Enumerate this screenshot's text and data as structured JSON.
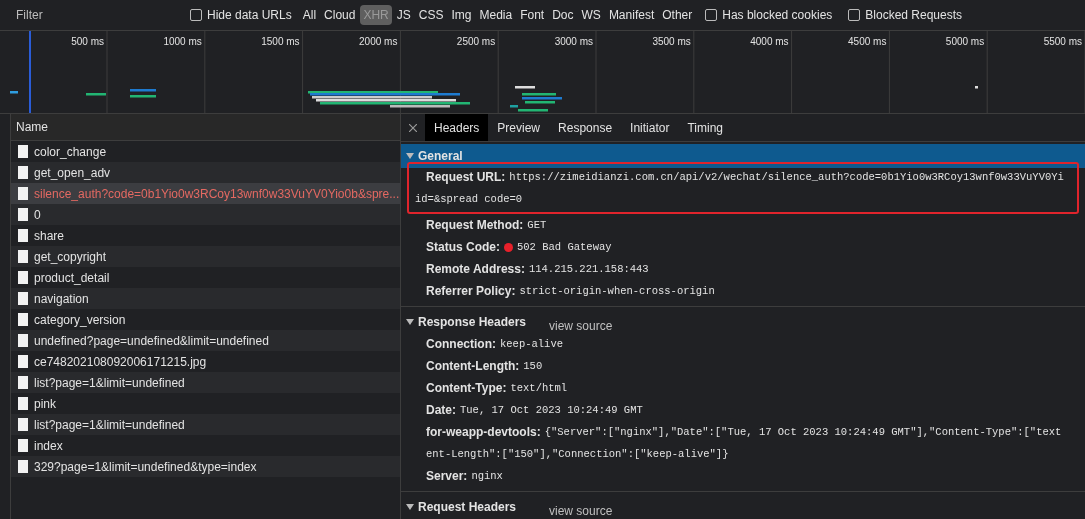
{
  "toolbar": {
    "filter": {
      "placeholder": "Filter"
    },
    "hide_data_urls": {
      "label": "Hide data URLs",
      "checked": false
    },
    "types": [
      {
        "label": "All",
        "selected": false
      },
      {
        "label": "Cloud",
        "selected": false
      },
      {
        "label": "XHR",
        "selected": true
      },
      {
        "label": "JS",
        "selected": false
      },
      {
        "label": "CSS",
        "selected": false
      },
      {
        "label": "Img",
        "selected": false
      },
      {
        "label": "Media",
        "selected": false
      },
      {
        "label": "Font",
        "selected": false
      },
      {
        "label": "Doc",
        "selected": false
      },
      {
        "label": "WS",
        "selected": false
      },
      {
        "label": "Manifest",
        "selected": false
      },
      {
        "label": "Other",
        "selected": false
      }
    ],
    "checkboxes": [
      {
        "label": "Has blocked cookies",
        "checked": false
      },
      {
        "label": "Blocked Requests",
        "checked": false
      }
    ]
  },
  "overview": {
    "ticks": [
      "500 ms",
      "1000 ms",
      "1500 ms",
      "2000 ms",
      "2500 ms",
      "3000 ms",
      "3500 ms",
      "4000 ms",
      "4500 ms",
      "5000 ms",
      "5500 ms"
    ]
  },
  "requests": {
    "column": "Name",
    "rows": [
      {
        "name": "color_change",
        "error": false,
        "selected": false
      },
      {
        "name": "get_open_adv",
        "error": false,
        "selected": false
      },
      {
        "name": "silence_auth?code=0b1Yio0w3RCoy13wnf0w33VuYV0Yio0b&spre...",
        "error": true,
        "selected": true
      },
      {
        "name": "0",
        "error": false,
        "selected": false
      },
      {
        "name": "share",
        "error": false,
        "selected": false
      },
      {
        "name": "get_copyright",
        "error": false,
        "selected": false
      },
      {
        "name": "product_detail",
        "error": false,
        "selected": false
      },
      {
        "name": "navigation",
        "error": false,
        "selected": false
      },
      {
        "name": "category_version",
        "error": false,
        "selected": false
      },
      {
        "name": "undefined?page=undefined&limit=undefined",
        "error": false,
        "selected": false
      },
      {
        "name": "ce748202108092006171215.jpg",
        "error": false,
        "selected": false
      },
      {
        "name": "list?page=1&limit=undefined",
        "error": false,
        "selected": false
      },
      {
        "name": "pink",
        "error": false,
        "selected": false
      },
      {
        "name": "list?page=1&limit=undefined",
        "error": false,
        "selected": false
      },
      {
        "name": "index",
        "error": false,
        "selected": false
      },
      {
        "name": "329?page=1&limit=undefined&type=index",
        "error": false,
        "selected": false
      }
    ]
  },
  "details": {
    "tabs": [
      {
        "label": "Headers",
        "selected": true
      },
      {
        "label": "Preview",
        "selected": false
      },
      {
        "label": "Response",
        "selected": false
      },
      {
        "label": "Initiator",
        "selected": false
      },
      {
        "label": "Timing",
        "selected": false
      }
    ],
    "sections": [
      {
        "title": "General",
        "expanded": true,
        "highlighted": true,
        "rows": [
          {
            "name": "Request URL:",
            "value_lines": [
              "https://zimeidianzi.com.cn/api/v2/wechat/silence_auth?code=0b1Yio0w3RCoy13wnf0w33VuYV0Yi",
              "id=&spread code=0"
            ],
            "marked": true,
            "kind": "text"
          },
          {
            "name": "Request Method:",
            "value_lines": [
              "GET"
            ],
            "marked": false,
            "kind": "text"
          },
          {
            "name": "Status Code:",
            "value_lines": [
              "502 Bad Gateway"
            ],
            "marked": false,
            "kind": "status",
            "color": "#e8202a"
          },
          {
            "name": "Remote Address:",
            "value_lines": [
              "114.215.221.158:443"
            ],
            "marked": false,
            "kind": "text"
          },
          {
            "name": "Referrer Policy:",
            "value_lines": [
              "strict-origin-when-cross-origin"
            ],
            "marked": false,
            "kind": "text"
          }
        ]
      },
      {
        "title": "Response Headers",
        "expanded": true,
        "highlighted": false,
        "link": "view source",
        "rows": [
          {
            "name": "Connection:",
            "value_lines": [
              "keep-alive"
            ],
            "marked": false,
            "kind": "text"
          },
          {
            "name": "Content-Length:",
            "value_lines": [
              "150"
            ],
            "marked": false,
            "kind": "text"
          },
          {
            "name": "Content-Type:",
            "value_lines": [
              "text/html"
            ],
            "marked": false,
            "kind": "text"
          },
          {
            "name": "Date:",
            "value_lines": [
              "Tue, 17 Oct 2023 10:24:49 GMT"
            ],
            "marked": false,
            "kind": "text"
          },
          {
            "name": "for-weapp-devtools:",
            "value_lines": [
              "{\"Server\":[\"nginx\"],\"Date\":[\"Tue, 17 Oct 2023 10:24:49 GMT\"],\"Content-Type\":[\"text",
              "ent-Length\":[\"150\"],\"Connection\":[\"keep-alive\"]}"
            ],
            "marked": false,
            "kind": "text"
          },
          {
            "name": "Server:",
            "value_lines": [
              "nginx"
            ],
            "marked": false,
            "kind": "text"
          }
        ]
      },
      {
        "title": "Request Headers",
        "expanded": true,
        "highlighted": false,
        "link": "view source"
      }
    ]
  }
}
